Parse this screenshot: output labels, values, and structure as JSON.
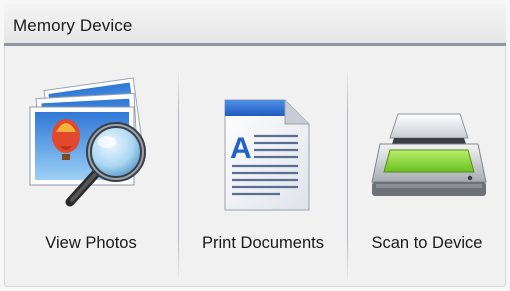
{
  "header": {
    "title": "Memory Device"
  },
  "tiles": [
    {
      "label": "View Photos",
      "icon": "photos-magnifier-icon"
    },
    {
      "label": "Print Documents",
      "icon": "document-icon"
    },
    {
      "label": "Scan to Device",
      "icon": "scanner-icon"
    }
  ],
  "colors": {
    "title_rule": "#8f97a6",
    "doc_header": "#2f6fd0",
    "scanner_glass": "#8ed33a"
  }
}
